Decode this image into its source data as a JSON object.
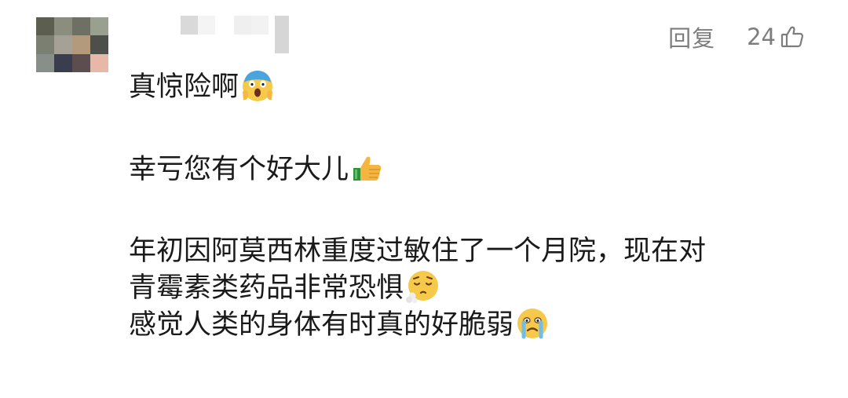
{
  "comment": {
    "actions": {
      "reply_label": "回复",
      "like_count": "24"
    },
    "paragraphs": [
      {
        "lines": [
          "真惊险啊"
        ],
        "emoji": "screaming-face-icon"
      },
      {
        "lines": [
          "幸亏您有个好大儿"
        ],
        "emoji": "thumbs-up-icon"
      },
      {
        "lines": [
          "年初因阿莫西林重度过敏住了一个月院，现在对",
          "青霉素类药品非常恐惧",
          "感觉人类的身体有时真的好脆弱"
        ],
        "line_emojis": [
          "",
          "sighing-face-icon",
          "crying-face-icon"
        ]
      }
    ]
  },
  "avatar": {
    "style": "pixelated",
    "colors": [
      "#5c5f4f",
      "#8b8e7f",
      "#6f7064",
      "#9aa090",
      "#7b7f72",
      "#a6a197",
      "#b39a7c",
      "#4d4f4a",
      "#888f8a",
      "#3a3d4d",
      "#5c4d4e",
      "#e7b8a8"
    ]
  },
  "username": {
    "style": "pixelated"
  }
}
